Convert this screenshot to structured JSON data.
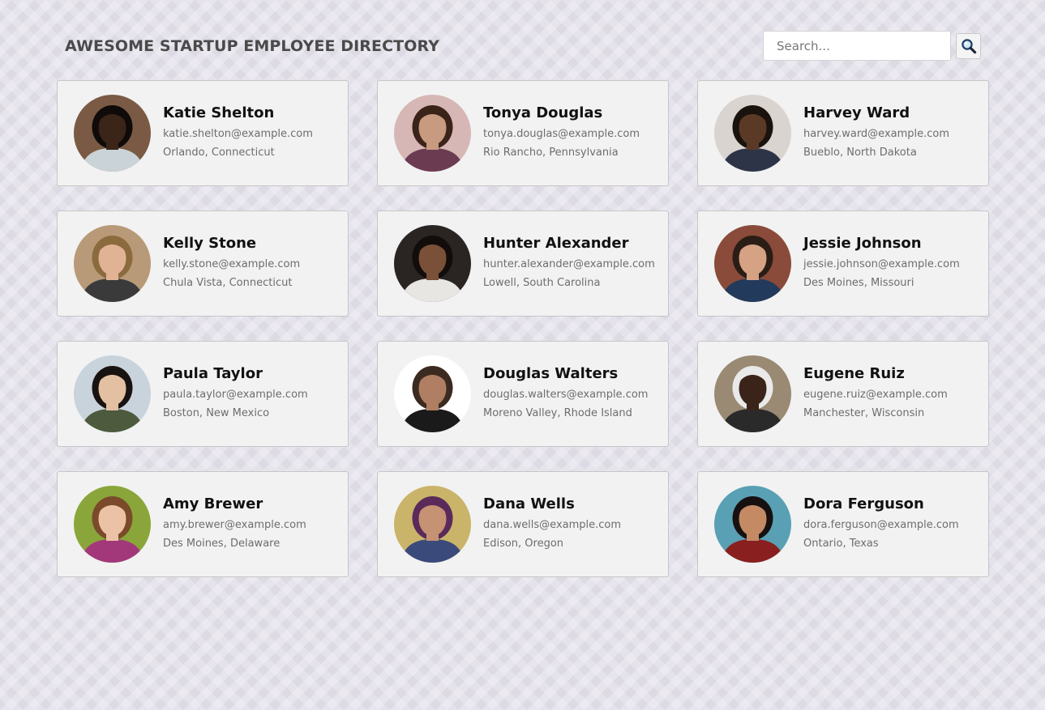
{
  "header": {
    "title": "AWESOME STARTUP EMPLOYEE DIRECTORY"
  },
  "search": {
    "placeholder": "Search...",
    "value": "",
    "button_icon": "magnifier-icon"
  },
  "employees": [
    {
      "name": "Katie Shelton",
      "email": "katie.shelton@example.com",
      "location": "Orlando, Connecticut",
      "photo": {
        "bg": "#7a5a44",
        "skin": "#3b2418",
        "hair": "#0e0b09",
        "shirt": "#c9d3d8"
      }
    },
    {
      "name": "Tonya Douglas",
      "email": "tonya.douglas@example.com",
      "location": "Rio Rancho, Pennsylvania",
      "photo": {
        "bg": "#d7b7b5",
        "skin": "#c89a80",
        "hair": "#3a2318",
        "shirt": "#6b3b52"
      }
    },
    {
      "name": "Harvey Ward",
      "email": "harvey.ward@example.com",
      "location": "Bueblo, North Dakota",
      "photo": {
        "bg": "#d9d4d0",
        "skin": "#5a3a27",
        "hair": "#1a120d",
        "shirt": "#2e3448"
      }
    },
    {
      "name": "Kelly Stone",
      "email": "kelly.stone@example.com",
      "location": "Chula Vista, Connecticut",
      "photo": {
        "bg": "#b89a78",
        "skin": "#e0b394",
        "hair": "#8b6a3e",
        "shirt": "#3a3a3a"
      }
    },
    {
      "name": "Hunter Alexander",
      "email": "hunter.alexander@example.com",
      "location": "Lowell, South Carolina",
      "photo": {
        "bg": "#2a2522",
        "skin": "#7a5038",
        "hair": "#120d0a",
        "shirt": "#e8e6e2"
      }
    },
    {
      "name": "Jessie Johnson",
      "email": "jessie.johnson@example.com",
      "location": "Des Moines, Missouri",
      "photo": {
        "bg": "#8a4b3a",
        "skin": "#d6a284",
        "hair": "#2a1d16",
        "shirt": "#223a5c"
      }
    },
    {
      "name": "Paula Taylor",
      "email": "paula.taylor@example.com",
      "location": "Boston, New Mexico",
      "photo": {
        "bg": "#c9d3dc",
        "skin": "#e3c0a2",
        "hair": "#181311",
        "shirt": "#4d5a3e"
      }
    },
    {
      "name": "Douglas Walters",
      "email": "douglas.walters@example.com",
      "location": "Moreno Valley, Rhode Island",
      "photo": {
        "bg": "#ffffff",
        "skin": "#b07e62",
        "hair": "#3b2a20",
        "shirt": "#1a1a1a"
      }
    },
    {
      "name": "Eugene Ruiz",
      "email": "eugene.ruiz@example.com",
      "location": "Manchester, Wisconsin",
      "photo": {
        "bg": "#9a8a74",
        "skin": "#3a2419",
        "hair": "#e9e9e9",
        "shirt": "#2a2a2a"
      }
    },
    {
      "name": "Amy Brewer",
      "email": "amy.brewer@example.com",
      "location": "Des Moines, Delaware",
      "photo": {
        "bg": "#8aa63a",
        "skin": "#ecc2a6",
        "hair": "#7a4a2a",
        "shirt": "#a2387a"
      }
    },
    {
      "name": "Dana Wells",
      "email": "dana.wells@example.com",
      "location": "Edison, Oregon",
      "photo": {
        "bg": "#c9b46a",
        "skin": "#c69274",
        "hair": "#5a2a5a",
        "shirt": "#3a4a7a"
      }
    },
    {
      "name": "Dora Ferguson",
      "email": "dora.ferguson@example.com",
      "location": "Ontario, Texas",
      "photo": {
        "bg": "#5aa0b4",
        "skin": "#c48a64",
        "hair": "#161110",
        "shirt": "#8a1f1f"
      }
    }
  ]
}
